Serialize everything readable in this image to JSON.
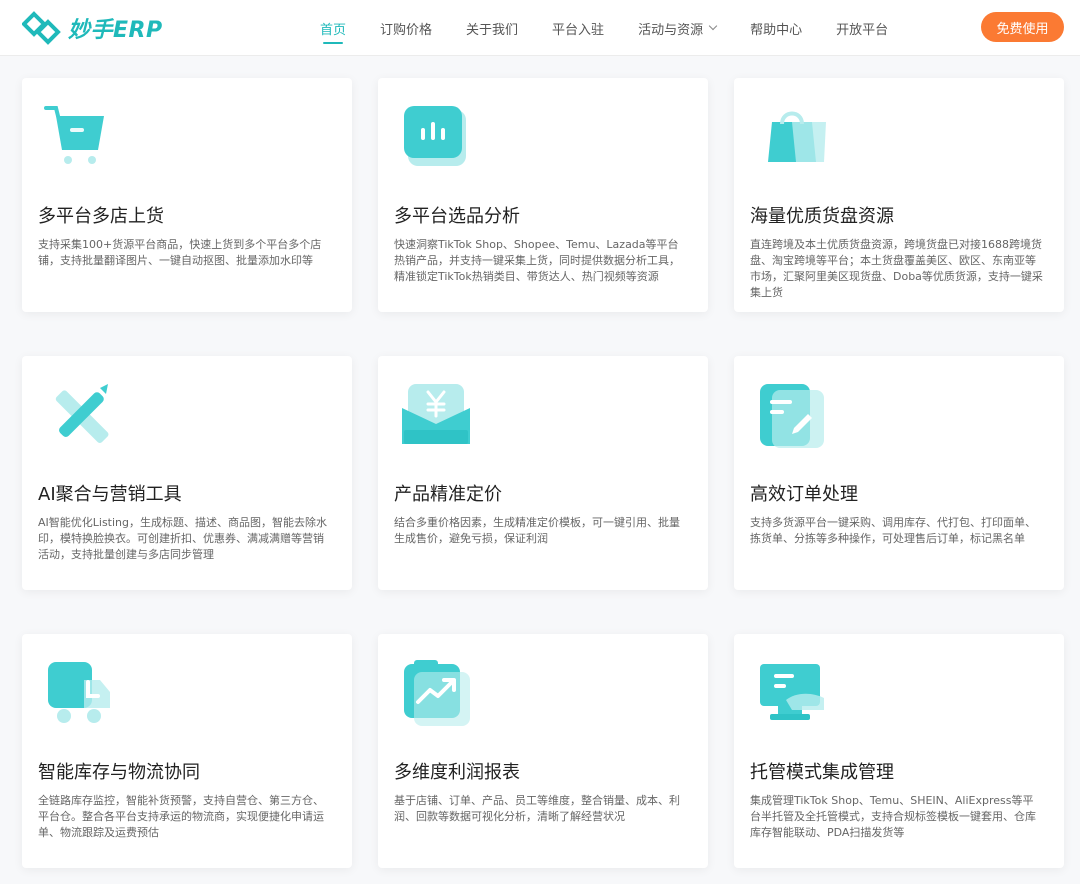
{
  "brand": {
    "name": "妙手ERP",
    "accent": "#1fb9ba",
    "cta_color": "#fb7a33"
  },
  "nav": {
    "items": [
      {
        "label": "首页",
        "active": true
      },
      {
        "label": "订购价格"
      },
      {
        "label": "关于我们"
      },
      {
        "label": "平台入驻"
      },
      {
        "label": "活动与资源",
        "icon": "chevron-down-icon"
      },
      {
        "label": "帮助中心"
      },
      {
        "label": "开放平台"
      }
    ],
    "cta": "免费使用"
  },
  "features": [
    {
      "icon": "shopping-cart-icon",
      "title": "多平台多店上货",
      "desc": "支持采集100+货源平台商品，快速上货到多个平台多个店铺，支持批量翻译图片、一键自动抠图、批量添加水印等"
    },
    {
      "icon": "bar-chart-icon",
      "title": "多平台选品分析",
      "desc": "快速洞察TikTok Shop、Shopee、Temu、Lazada等平台热销产品，并支持一键采集上货，同时提供数据分析工具，精准锁定TikTok热销类目、带货达人、热门视频等资源"
    },
    {
      "icon": "shopping-bag-icon",
      "title": "海量优质货盘资源",
      "desc": "直连跨境及本土优质货盘资源，跨境货盘已对接1688跨境货盘、淘宝跨境等平台；本土货盘覆盖美区、欧区、东南亚等市场，汇聚阿里美区现货盘、Doba等优质货源，支持一键采集上货"
    },
    {
      "icon": "pen-ruler-icon",
      "title": "AI聚合与营销工具",
      "desc": "AI智能优化Listing，生成标题、描述、商品图，智能去除水印，模特换脸换衣。可创建折扣、优惠券、满减满赠等营销活动，支持批量创建与多店同步管理"
    },
    {
      "icon": "yuan-price-icon",
      "title": "产品精准定价",
      "desc": "结合多重价格因素，生成精准定价模板，可一键引用、批量生成售价，避免亏损，保证利润"
    },
    {
      "icon": "order-edit-icon",
      "title": "高效订单处理",
      "desc": "支持多货源平台一键采购、调用库存、代打包、打印面单、拣货单、分拣等多种操作，可处理售后订单，标记黑名单"
    },
    {
      "icon": "delivery-truck-icon",
      "title": "智能库存与物流协同",
      "desc": "全链路库存监控，智能补货预警，支持自营仓、第三方仓、平台仓。整合各平台支持承运的物流商，实现便捷化申请运单、物流跟踪及运费预估"
    },
    {
      "icon": "trend-report-icon",
      "title": "多维度利润报表",
      "desc": "基于店铺、订单、产品、员工等维度，整合销量、成本、利润、回款等数据可视化分析，清晰了解经营状况"
    },
    {
      "icon": "hosted-management-icon",
      "title": "托管模式集成管理",
      "desc": "集成管理TikTok Shop、Temu、SHEIN、AliExpress等平台半托管及全托管模式，支持合规标签模板一键套用、仓库库存智能联动、PDA扫描发货等"
    }
  ]
}
